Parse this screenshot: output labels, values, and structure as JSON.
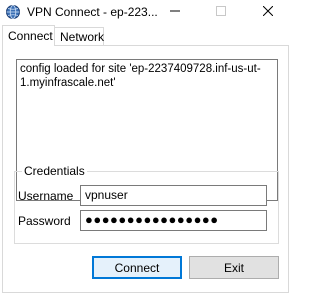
{
  "window": {
    "title": "VPN Connect - ep-223...",
    "icons": {
      "app": "globe-icon",
      "minimize": "minimize-icon",
      "maximize": "maximize-icon",
      "close": "close-icon"
    }
  },
  "tabs": [
    {
      "label": "Connect",
      "active": true
    },
    {
      "label": "Network",
      "active": false
    }
  ],
  "log": {
    "text": "config loaded for site 'ep-2237409728.inf-us-ut-1.myinfrascale.net'"
  },
  "credentials": {
    "legend": "Credentials",
    "username_label": "Username",
    "username_value": "vpnuser",
    "password_label": "Password",
    "password_value": "●●●●●●●●●●●●●●●●"
  },
  "buttons": {
    "connect": "Connect",
    "exit": "Exit"
  },
  "colors": {
    "focus_border": "#0078d7",
    "focus_fill": "#e5f1fb",
    "button_fill": "#e1e1e1"
  }
}
